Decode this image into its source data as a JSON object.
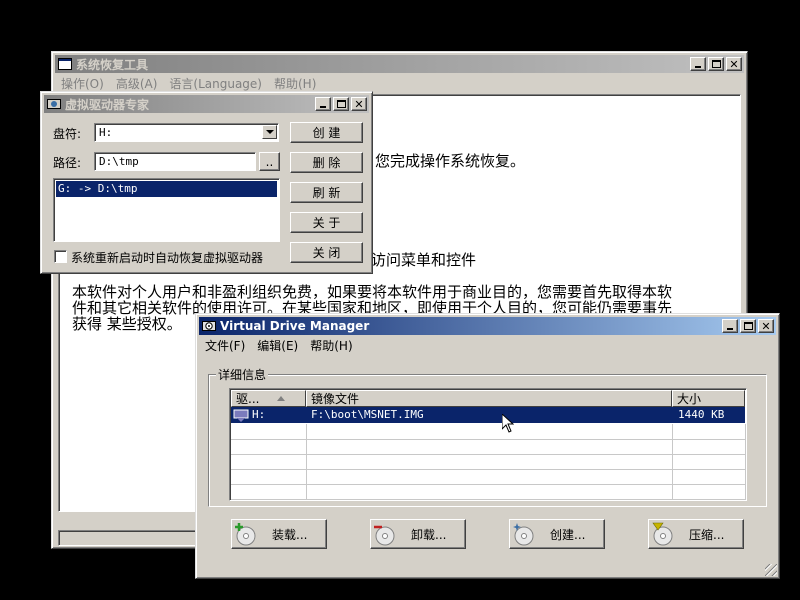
{
  "recovery": {
    "title": "系统恢复工具",
    "menu": [
      "操作(O)",
      "高级(A)",
      "语言(Language)",
      "帮助(H)"
    ],
    "text_line1": "您完成操作系统恢复。",
    "text_line2": "访问菜单和控件",
    "para_line1": "本软件对个人用户和非盈利组织免费，如果要将本软件用于商业目的，您需要首先取得本软",
    "para_line2": "件和其它相关软件的使用许可。在某些国家和地区，即使用于个人目的，您可能仍需要事先",
    "para_line3": "获得  某些授权。"
  },
  "expert": {
    "title": "虚拟驱动器专家",
    "drive_label": "盘符:",
    "drive_value": "H:",
    "path_label": "路径:",
    "path_value": "D:\\tmp",
    "browse_label": "..",
    "list_items": [
      "G: -> D:\\tmp"
    ],
    "buttons": {
      "create": "创 建",
      "delete": "删 除",
      "refresh": "刷 新",
      "about": "关 于",
      "close": "关 闭"
    },
    "checkbox_label": "系统重新启动时自动恢复虚拟驱动器"
  },
  "vdm": {
    "title": "Virtual Drive Manager",
    "menu": [
      "文件(F)",
      "编辑(E)",
      "帮助(H)"
    ],
    "group_label": "详细信息",
    "columns": [
      "驱...",
      "镜像文件",
      "大小"
    ],
    "rows": [
      {
        "drive": "H:",
        "image": "F:\\boot\\MSNET.IMG",
        "size": "1440 KB"
      }
    ],
    "buttons": {
      "mount": "装载...",
      "unmount": "卸载...",
      "create": "创建...",
      "compress": "压缩..."
    }
  },
  "colors": {
    "desktop": "#000000",
    "window_face": "#d4d0c8",
    "active_title": "#0a246a",
    "inactive_title": "#808080",
    "selection": "#0a246a"
  }
}
